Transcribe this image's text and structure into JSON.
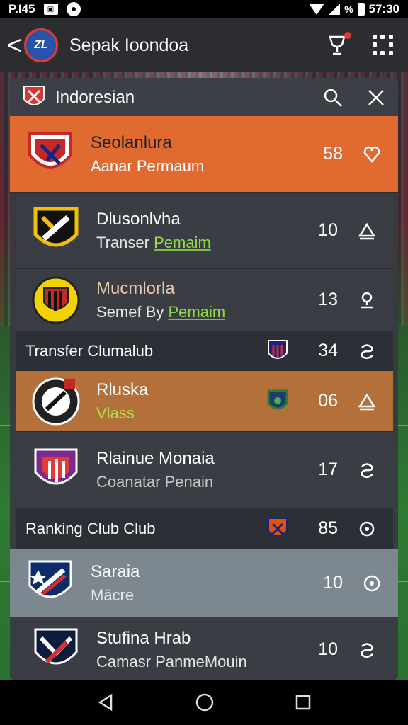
{
  "status_bar": {
    "time_left": "P.I45",
    "time_right": "57:30",
    "percent_glyph": "%",
    "icon_names": [
      "notification-box-icon",
      "circle-icon",
      "wifi-icon",
      "signal-icon",
      "battery-icon"
    ]
  },
  "app_bar": {
    "back_glyph": "<",
    "logo_text": "ZL",
    "title": "Sepak Ioondoa",
    "icons": [
      "trophy-icon",
      "grid-menu-icon"
    ]
  },
  "panel": {
    "header_title": "Indoresian",
    "header_icons": [
      "search-icon",
      "close-icon"
    ]
  },
  "rows": [
    {
      "name": "Seolanlura",
      "sub": "Aanar Permaum",
      "number": "58",
      "icon": "heart-icon"
    },
    {
      "name": "Dlusonlvha",
      "sub_plain": "Transer ",
      "sub_link": "Pemaim",
      "number": "10",
      "icon": "triangle-up-icon"
    },
    {
      "name": "Mucmlorla",
      "sub_plain": "Semef By ",
      "sub_link": "Pemaim",
      "number": "13",
      "icon": "pin-icon"
    },
    {
      "section": "Transfer Clumalub",
      "number": "34",
      "icon": "swirl-icon"
    },
    {
      "name": "Rluska",
      "sub": "Vlass",
      "number": "06",
      "icon": "triangle-up-icon"
    },
    {
      "name": "Rlainue Monaia",
      "sub": "Coanatar Penain",
      "number": "17",
      "icon": "swirl-icon"
    },
    {
      "section": "Ranking Club Club",
      "number": "85",
      "icon": "gear-icon"
    },
    {
      "name": "Saraia",
      "sub": "Mäcre",
      "number": "10",
      "icon": "target-icon"
    },
    {
      "name": "Stufina Hrab",
      "sub": "Camasr PanmeMouin",
      "number": "10",
      "icon": "swirl-icon"
    }
  ],
  "nav_bar": {
    "icons": [
      "back-triangle-icon",
      "home-circle-icon",
      "recents-square-icon"
    ]
  },
  "colors": {
    "accent_orange": "#e06a2f",
    "accent_amber": "#b4703a",
    "link_green": "#8fdc4a",
    "panel_bg": "#373a40",
    "highlight_row": "#7d8790"
  }
}
